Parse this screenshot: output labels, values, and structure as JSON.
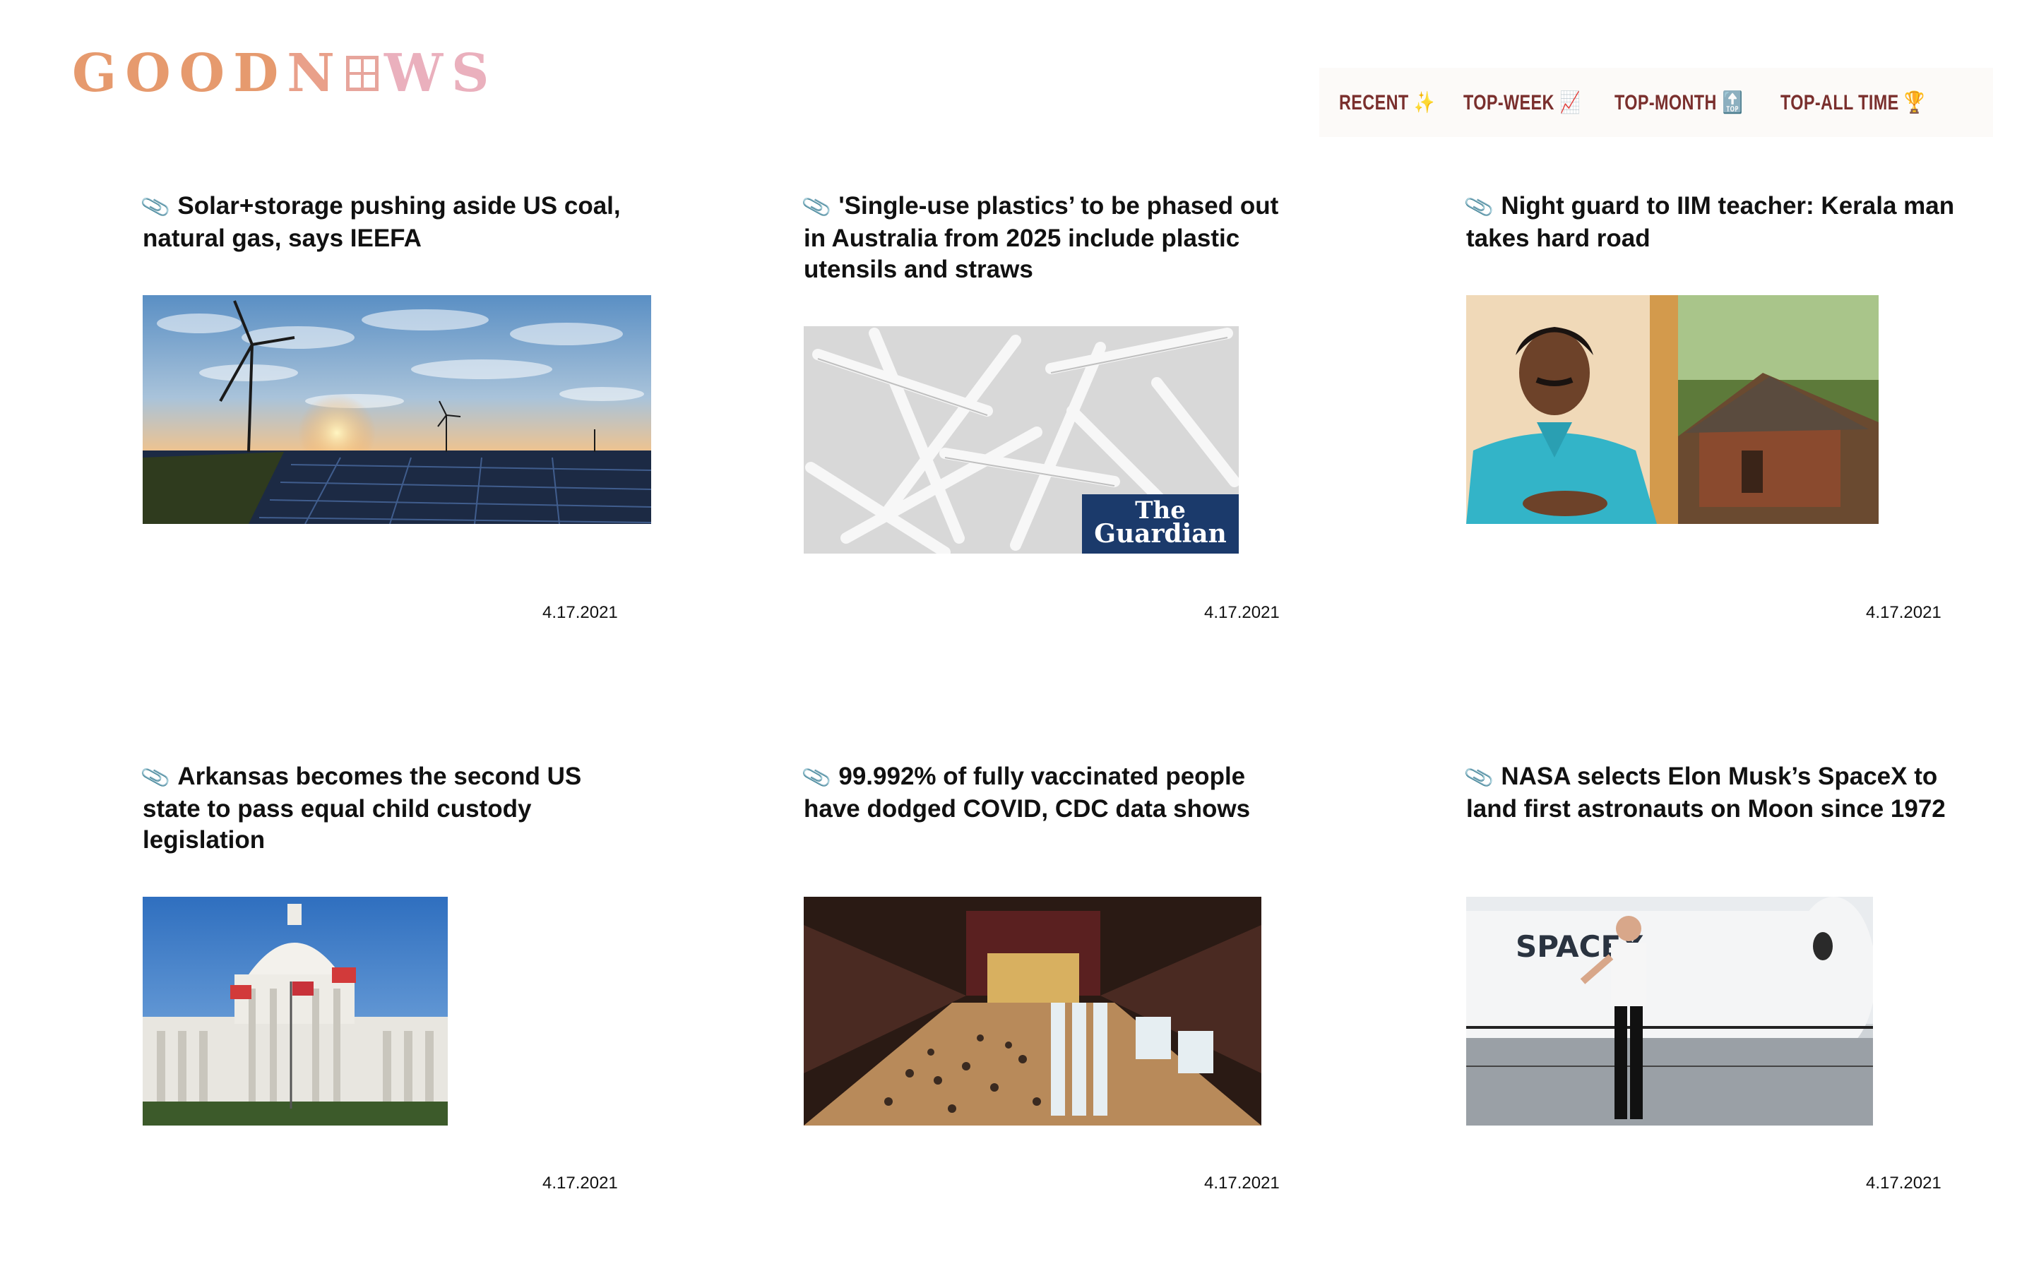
{
  "logo": {
    "part1": "GOOD",
    "part2": "N",
    "part3": "WS"
  },
  "nav": [
    {
      "label": "RECENT",
      "icon": "✨"
    },
    {
      "label": "TOP-WEEK",
      "icon": "📈"
    },
    {
      "label": "TOP-MONTH",
      "icon": "🔝"
    },
    {
      "label": "TOP-ALL TIME",
      "icon": "🏆"
    }
  ],
  "articles": [
    {
      "pin": "📎",
      "title": "Solar+storage pushing aside US coal, natural gas, says IEEFA",
      "date": "4.17.2021",
      "image": "wind-turbine-solar-panels"
    },
    {
      "pin": "📎",
      "title": "'Single-use plastics’ to be phased out in Australia from 2025 include plastic utensils and straws",
      "date": "4.17.2021",
      "image": "plastic-forks",
      "image_label": "The Guardian"
    },
    {
      "pin": "📎",
      "title": "Night guard to IIM teacher: Kerala man takes hard road",
      "date": "4.17.2021",
      "image": "man-and-hut"
    },
    {
      "pin": "📎",
      "title": "Arkansas becomes the second US state to pass equal child custody legislation",
      "date": "4.17.2021",
      "image": "capitol-building"
    },
    {
      "pin": "📎",
      "title": "99.992% of fully vaccinated people have dodged COVID, CDC data shows",
      "date": "4.17.2021",
      "image": "vaccination-hall"
    },
    {
      "pin": "📎",
      "title": "NASA selects Elon Musk’s SpaceX to land first astronauts on Moon since 1972",
      "date": "4.17.2021",
      "image": "spacex-rocket",
      "image_label": "SPACEX"
    }
  ]
}
